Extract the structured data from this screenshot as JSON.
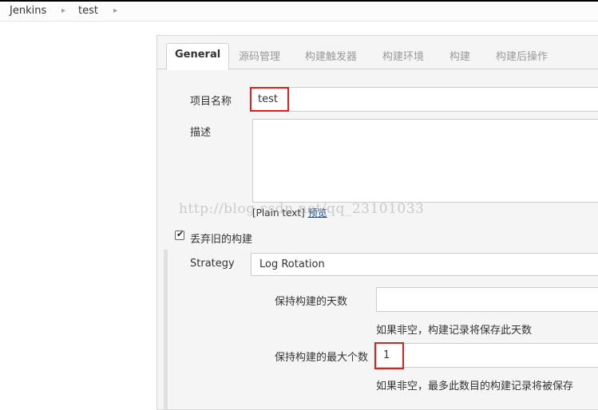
{
  "breadcrumb": {
    "root": "Jenkins",
    "item": "test"
  },
  "tabs": [
    "General",
    "源码管理",
    "构建触发器",
    "构建环境",
    "构建",
    "构建后操作"
  ],
  "general": {
    "project_name_label": "项目名称",
    "project_name_value": "test",
    "description_label": "描述",
    "description_value": "",
    "plain_text": "[Plain text]",
    "preview_link": "预览"
  },
  "discard": {
    "checkbox_label": "丢弃旧的构建",
    "checked": true,
    "strategy_label": "Strategy",
    "strategy_value": "Log Rotation",
    "days_label": "保持构建的天数",
    "days_value": "",
    "days_hint": "如果非空，构建记录将保存此天数",
    "max_label": "保持构建的最大个数",
    "max_value": "1",
    "max_hint": "如果非空，最多此数目的构建记录将被保存"
  },
  "watermark": "http://blog.csdn.net/qq_23101033",
  "colors": {
    "highlight": "#e02020",
    "link": "#204a87",
    "panel_bg": "#f5f5f5"
  }
}
